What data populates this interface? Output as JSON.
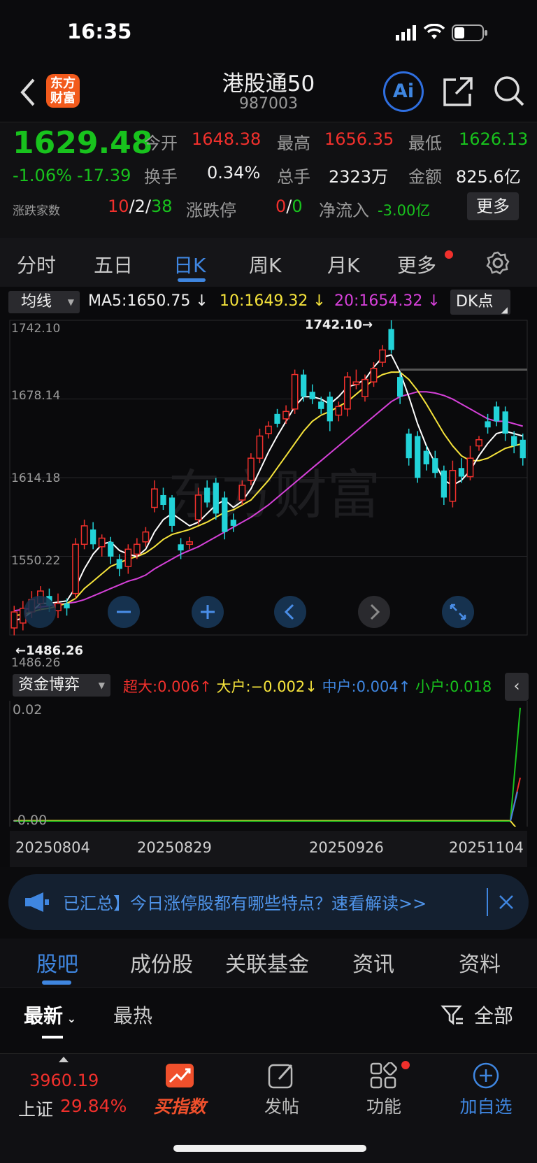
{
  "status": {
    "time": "16:35"
  },
  "nav": {
    "title": "港股通50",
    "code": "987003",
    "logo_line1": "东方",
    "logo_line2": "财富",
    "ai_label": "Ai"
  },
  "quote": {
    "price": "1629.48",
    "change_pct": "-1.06%",
    "change": "-17.39",
    "open_label": "今开",
    "open": "1648.38",
    "high_label": "最高",
    "high": "1656.35",
    "low_label": "最低",
    "low": "1626.13",
    "turnover_label": "换手",
    "turnover": "0.34%",
    "volume_label": "总手",
    "volume": "2323万",
    "amount_label": "金额",
    "amount": "825.6亿",
    "breadth_label": "涨跌家数",
    "breadth_up": "10",
    "breadth_sep1": "/",
    "breadth_flat": "2",
    "breadth_sep2": "/",
    "breadth_down": "38",
    "limit_label": "涨跌停",
    "limit_up": "0",
    "limit_sep": "/",
    "limit_down": "0",
    "netflow_label": "净流入",
    "netflow": "-3.00亿",
    "more_label": "更多"
  },
  "tabs": [
    "分时",
    "五日",
    "日K",
    "周K",
    "月K",
    "更多"
  ],
  "indicator": {
    "selector": "均线",
    "ma5": "MA5:1650.75",
    "ma10": "10:1649.32",
    "ma20": "20:1654.32",
    "dk": "DK点"
  },
  "price_axis": {
    "top": "1742.10",
    "l2": "1678.14",
    "l3": "1614.18",
    "l4": "1550.22",
    "bottom": "1486.26"
  },
  "markers": {
    "high": "1742.10",
    "low": "1486.26"
  },
  "fund": {
    "selector": "资金博弈",
    "super": "超大:0.006",
    "large": "大户:−0.002",
    "mid": "中户:0.004",
    "small": "小户:0.018",
    "axis_top": "0.02",
    "axis_zero": "-0.00"
  },
  "dates": [
    "20250804",
    "20250829",
    "20250926",
    "20251104"
  ],
  "banner": {
    "text": "已汇总】今日涨停股都有哪些特点？速看解读>>"
  },
  "subtabs": [
    "股吧",
    "成份股",
    "关联基金",
    "资讯",
    "资料"
  ],
  "sort": {
    "latest": "最新",
    "hot": "最热",
    "all": "全部"
  },
  "bottom": {
    "index_value": "3960.19",
    "index_name": "上证",
    "index_pct": "29.84%",
    "buy": "买指数",
    "post": "发帖",
    "func": "功能",
    "add": "加自选"
  },
  "colors": {
    "up": "#f0302c",
    "down": "#18c21d",
    "candle_down": "#22d3d8",
    "ma5": "#ffffff",
    "ma10": "#f5e33b",
    "ma20": "#d540d8",
    "accent": "#3f86e0"
  },
  "chart_data": {
    "type": "candlestick",
    "ylim": [
      1486.26,
      1742.1
    ],
    "candles": [
      {
        "o": 1492,
        "c": 1505,
        "h": 1510,
        "l": 1486
      },
      {
        "o": 1496,
        "c": 1508,
        "h": 1514,
        "l": 1490
      },
      {
        "o": 1505,
        "c": 1515,
        "h": 1522,
        "l": 1500
      },
      {
        "o": 1512,
        "c": 1522,
        "h": 1526,
        "l": 1506
      },
      {
        "o": 1518,
        "c": 1510,
        "h": 1524,
        "l": 1505
      },
      {
        "o": 1506,
        "c": 1512,
        "h": 1520,
        "l": 1500
      },
      {
        "o": 1512,
        "c": 1508,
        "h": 1516,
        "l": 1502
      },
      {
        "o": 1520,
        "c": 1560,
        "h": 1565,
        "l": 1516
      },
      {
        "o": 1560,
        "c": 1575,
        "h": 1580,
        "l": 1556
      },
      {
        "o": 1572,
        "c": 1560,
        "h": 1578,
        "l": 1556
      },
      {
        "o": 1558,
        "c": 1565,
        "h": 1568,
        "l": 1550
      },
      {
        "o": 1562,
        "c": 1550,
        "h": 1566,
        "l": 1544
      },
      {
        "o": 1548,
        "c": 1540,
        "h": 1552,
        "l": 1534
      },
      {
        "o": 1542,
        "c": 1556,
        "h": 1560,
        "l": 1536
      },
      {
        "o": 1552,
        "c": 1560,
        "h": 1565,
        "l": 1548
      },
      {
        "o": 1562,
        "c": 1570,
        "h": 1574,
        "l": 1558
      },
      {
        "o": 1590,
        "c": 1605,
        "h": 1612,
        "l": 1586
      },
      {
        "o": 1600,
        "c": 1592,
        "h": 1606,
        "l": 1588
      },
      {
        "o": 1598,
        "c": 1575,
        "h": 1600,
        "l": 1570
      },
      {
        "o": 1560,
        "c": 1555,
        "h": 1565,
        "l": 1548
      },
      {
        "o": 1560,
        "c": 1562,
        "h": 1566,
        "l": 1556
      },
      {
        "o": 1580,
        "c": 1600,
        "h": 1606,
        "l": 1576
      },
      {
        "o": 1606,
        "c": 1594,
        "h": 1612,
        "l": 1590
      },
      {
        "o": 1610,
        "c": 1585,
        "h": 1614,
        "l": 1580
      },
      {
        "o": 1598,
        "c": 1570,
        "h": 1603,
        "l": 1564
      },
      {
        "o": 1580,
        "c": 1575,
        "h": 1585,
        "l": 1570
      },
      {
        "o": 1596,
        "c": 1608,
        "h": 1612,
        "l": 1592
      },
      {
        "o": 1612,
        "c": 1630,
        "h": 1634,
        "l": 1608
      },
      {
        "o": 1630,
        "c": 1648,
        "h": 1654,
        "l": 1626
      },
      {
        "o": 1650,
        "c": 1656,
        "h": 1660,
        "l": 1646
      },
      {
        "o": 1666,
        "c": 1658,
        "h": 1670,
        "l": 1655
      },
      {
        "o": 1662,
        "c": 1668,
        "h": 1673,
        "l": 1658
      },
      {
        "o": 1670,
        "c": 1698,
        "h": 1702,
        "l": 1666
      },
      {
        "o": 1698,
        "c": 1680,
        "h": 1702,
        "l": 1676
      },
      {
        "o": 1684,
        "c": 1678,
        "h": 1690,
        "l": 1674
      },
      {
        "o": 1676,
        "c": 1670,
        "h": 1680,
        "l": 1666
      },
      {
        "o": 1680,
        "c": 1660,
        "h": 1684,
        "l": 1652
      },
      {
        "o": 1665,
        "c": 1672,
        "h": 1676,
        "l": 1660
      },
      {
        "o": 1670,
        "c": 1696,
        "h": 1700,
        "l": 1664
      },
      {
        "o": 1690,
        "c": 1692,
        "h": 1702,
        "l": 1686
      },
      {
        "o": 1680,
        "c": 1694,
        "h": 1698,
        "l": 1676
      },
      {
        "o": 1692,
        "c": 1703,
        "h": 1708,
        "l": 1688
      },
      {
        "o": 1708,
        "c": 1718,
        "h": 1722,
        "l": 1704
      },
      {
        "o": 1735,
        "c": 1718,
        "h": 1742.1,
        "l": 1715
      },
      {
        "o": 1696,
        "c": 1680,
        "h": 1700,
        "l": 1674
      },
      {
        "o": 1650,
        "c": 1630,
        "h": 1654,
        "l": 1624
      },
      {
        "o": 1648,
        "c": 1614,
        "h": 1652,
        "l": 1610
      },
      {
        "o": 1636,
        "c": 1625,
        "h": 1640,
        "l": 1620
      },
      {
        "o": 1630,
        "c": 1618,
        "h": 1636,
        "l": 1614
      },
      {
        "o": 1620,
        "c": 1598,
        "h": 1624,
        "l": 1592
      },
      {
        "o": 1595,
        "c": 1620,
        "h": 1628,
        "l": 1590
      },
      {
        "o": 1622,
        "c": 1615,
        "h": 1630,
        "l": 1610
      },
      {
        "o": 1615,
        "c": 1630,
        "h": 1640,
        "l": 1612
      },
      {
        "o": 1640,
        "c": 1645,
        "h": 1648,
        "l": 1636
      },
      {
        "o": 1660,
        "c": 1655,
        "h": 1666,
        "l": 1650
      },
      {
        "o": 1672,
        "c": 1660,
        "h": 1676,
        "l": 1656
      },
      {
        "o": 1668,
        "c": 1650,
        "h": 1672,
        "l": 1644
      },
      {
        "o": 1648,
        "c": 1640,
        "h": 1652,
        "l": 1634
      },
      {
        "o": 1645,
        "c": 1630,
        "h": 1650,
        "l": 1624
      }
    ],
    "ma5": [
      1498,
      1500,
      1505,
      1512,
      1512,
      1513,
      1514,
      1525,
      1540,
      1552,
      1560,
      1562,
      1555,
      1552,
      1550,
      1556,
      1570,
      1580,
      1585,
      1580,
      1575,
      1578,
      1585,
      1592,
      1596,
      1590,
      1595,
      1605,
      1620,
      1635,
      1648,
      1660,
      1672,
      1680,
      1680,
      1678,
      1674,
      1680,
      1688,
      1690,
      1694,
      1704,
      1712,
      1714,
      1700,
      1680,
      1658,
      1640,
      1626,
      1612,
      1608,
      1612,
      1620,
      1632,
      1642,
      1650,
      1652,
      1650,
      1648
    ],
    "ma10": [
      1502,
      1503,
      1505,
      1507,
      1508,
      1510,
      1512,
      1516,
      1524,
      1530,
      1536,
      1542,
      1545,
      1548,
      1550,
      1553,
      1558,
      1564,
      1568,
      1570,
      1572,
      1575,
      1578,
      1582,
      1586,
      1588,
      1592,
      1596,
      1604,
      1612,
      1622,
      1632,
      1642,
      1652,
      1660,
      1665,
      1668,
      1672,
      1676,
      1682,
      1688,
      1694,
      1698,
      1700,
      1700,
      1694,
      1685,
      1674,
      1662,
      1650,
      1640,
      1632,
      1628,
      1628,
      1630,
      1634,
      1638,
      1640,
      1642
    ],
    "ma20": [
      1506,
      1507,
      1508,
      1509,
      1510,
      1511,
      1512,
      1513,
      1515,
      1518,
      1521,
      1524,
      1527,
      1530,
      1532,
      1535,
      1540,
      1544,
      1548,
      1552,
      1555,
      1558,
      1562,
      1566,
      1570,
      1574,
      1578,
      1582,
      1587,
      1592,
      1598,
      1604,
      1610,
      1616,
      1622,
      1628,
      1634,
      1640,
      1646,
      1652,
      1658,
      1664,
      1670,
      1676,
      1680,
      1682,
      1684,
      1684,
      1683,
      1681,
      1678,
      1674,
      1670,
      1666,
      1662,
      1660,
      1660,
      1658,
      1656
    ]
  }
}
